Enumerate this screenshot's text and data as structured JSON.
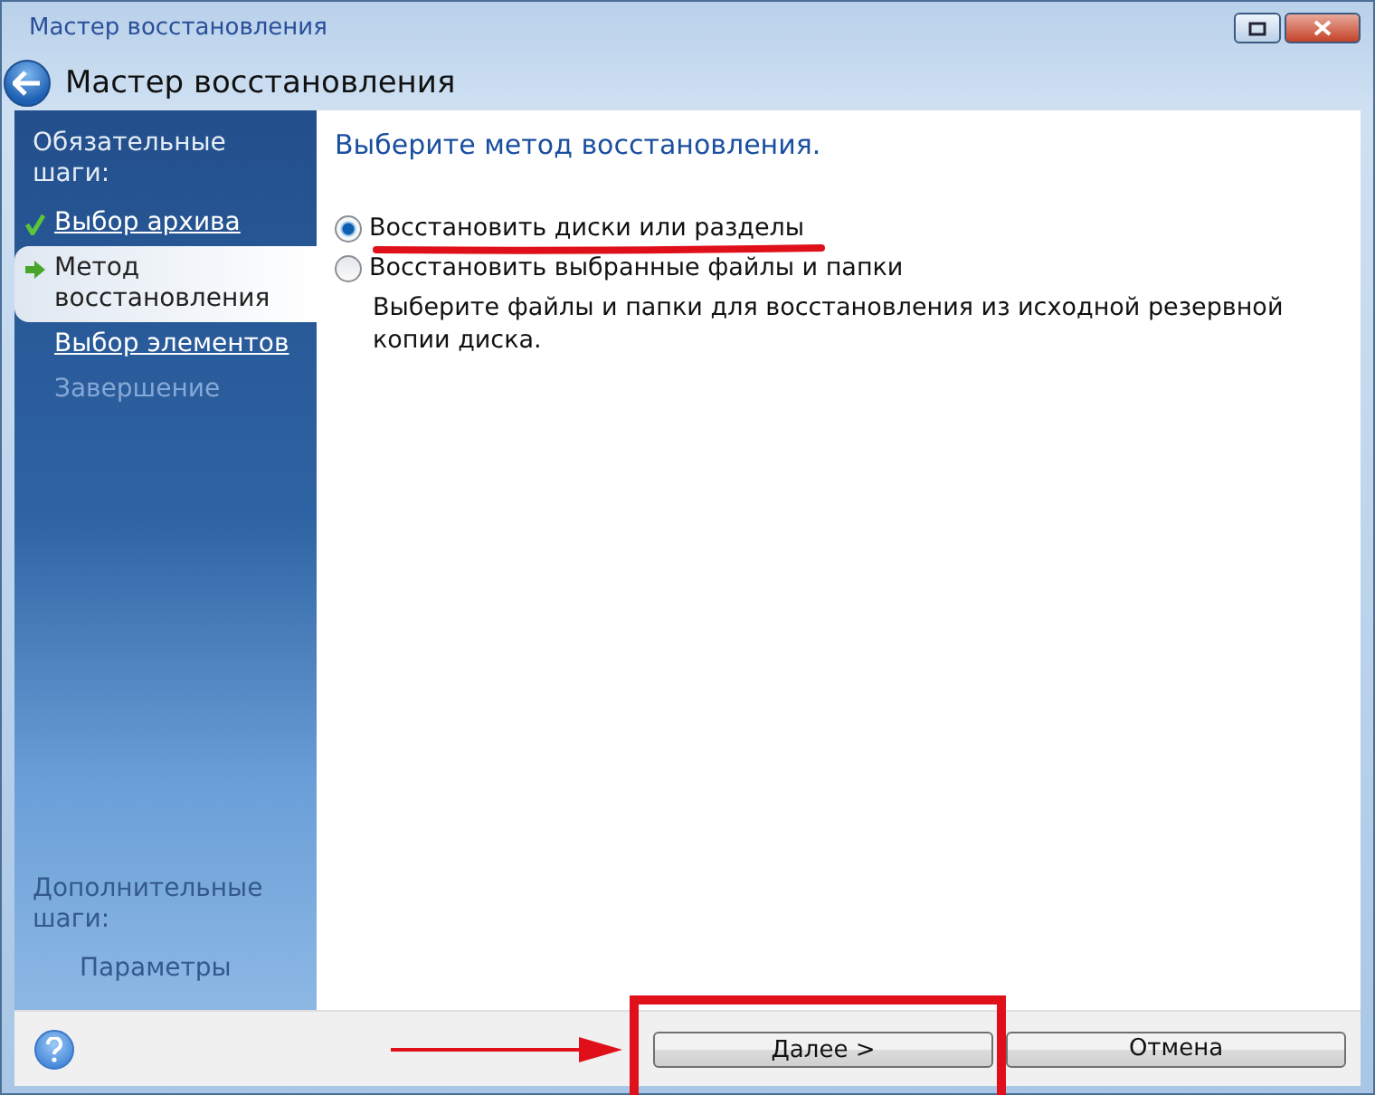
{
  "window": {
    "title": "Мастер восстановления"
  },
  "header": {
    "title": "Мастер восстановления"
  },
  "sidebar": {
    "required_heading": "Обязательные шаги:",
    "steps": [
      {
        "label": "Выбор архива",
        "kind": "done",
        "selected": false
      },
      {
        "label": "Метод восстановления",
        "kind": "current",
        "selected": true
      },
      {
        "label": "Выбор элементов",
        "kind": "link",
        "selected": false
      },
      {
        "label": "Завершение",
        "kind": "disabled",
        "selected": false
      }
    ],
    "optional_heading": "Дополнительные шаги:",
    "optional_steps": [
      {
        "label": "Параметры",
        "kind": "disabled",
        "selected": false
      }
    ]
  },
  "content": {
    "heading": "Выберите метод восстановления.",
    "options": [
      {
        "label": "Восстановить диски или разделы",
        "selected": true
      },
      {
        "label": "Восстановить выбранные файлы и папки",
        "selected": false,
        "description": "Выберите файлы и папки для восстановления из исходной резервной копии диска."
      }
    ]
  },
  "footer": {
    "buttons": [
      {
        "label": "Далее >",
        "kind": "primary"
      },
      {
        "label": "Отмена",
        "kind": "cancel"
      }
    ]
  }
}
